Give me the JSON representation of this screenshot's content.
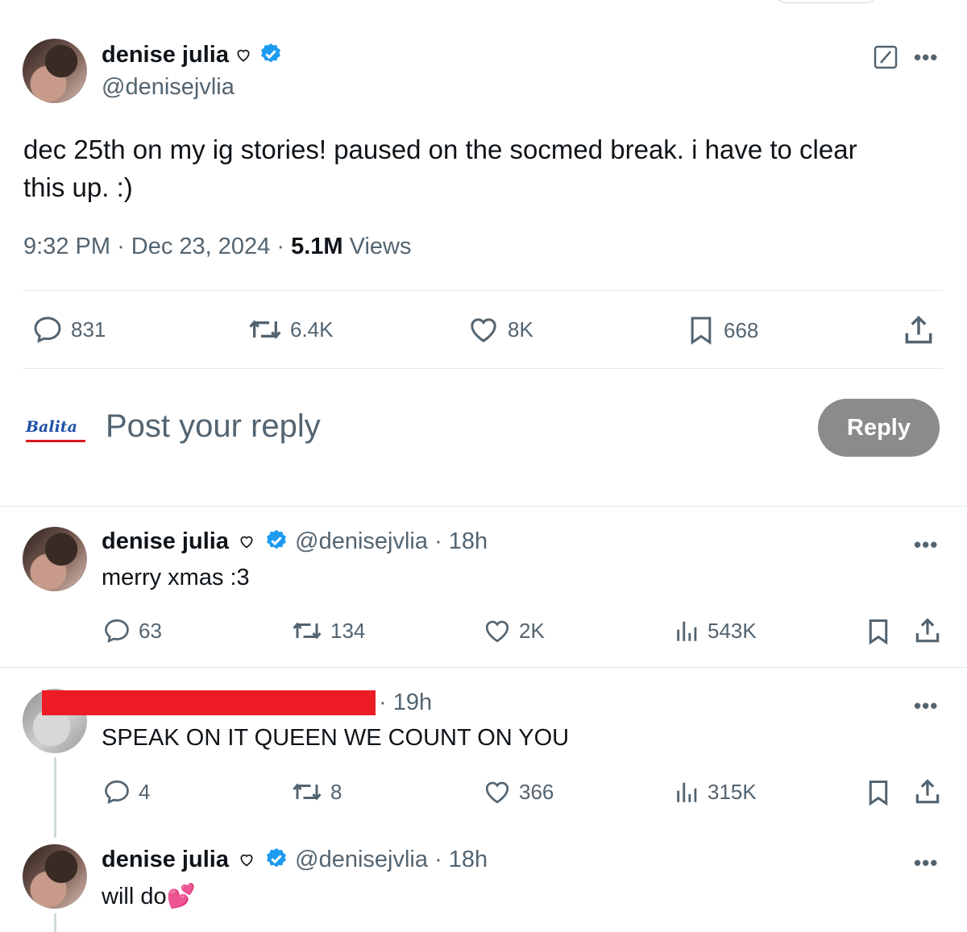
{
  "main_tweet": {
    "author": "denise julia",
    "handle": "@denisejvlia",
    "text_line1": "dec 25th on my ig stories! paused on the socmed break. i have to clear",
    "text_line2": "this up. :)",
    "time": "9:32 PM",
    "date": "Dec 23, 2024",
    "views_count": "5.1M",
    "views_label": "Views",
    "replies": "831",
    "reposts": "6.4K",
    "likes": "8K",
    "bookmarks": "668"
  },
  "composer": {
    "placeholder": "Post your reply",
    "logo_text": "Balita",
    "reply_label": "Reply"
  },
  "replies": [
    {
      "author": "denise julia",
      "handle": "@denisejvlia",
      "time": "18h",
      "text": "merry xmas :3",
      "replies": "63",
      "reposts": "134",
      "likes": "2K",
      "views": "543K"
    },
    {
      "author": "",
      "handle": "",
      "time": "19h",
      "text": "SPEAK ON IT QUEEN WE COUNT ON YOU",
      "replies": "4",
      "reposts": "8",
      "likes": "366",
      "views": "315K"
    },
    {
      "author": "denise julia",
      "handle": "@denisejvlia",
      "time": "18h",
      "text": "will do",
      "emoji": "💕"
    }
  ],
  "colors": {
    "verified": "#1d9bf0",
    "redaction": "#ee1c25",
    "reply_button": "#8b8b8b",
    "muted": "#536471"
  },
  "icons": [
    "verified-badge-icon",
    "heart-outline-icon",
    "edit-icon",
    "more-icon",
    "reply-icon",
    "repost-icon",
    "like-icon",
    "bookmark-icon",
    "share-icon",
    "views-icon"
  ]
}
